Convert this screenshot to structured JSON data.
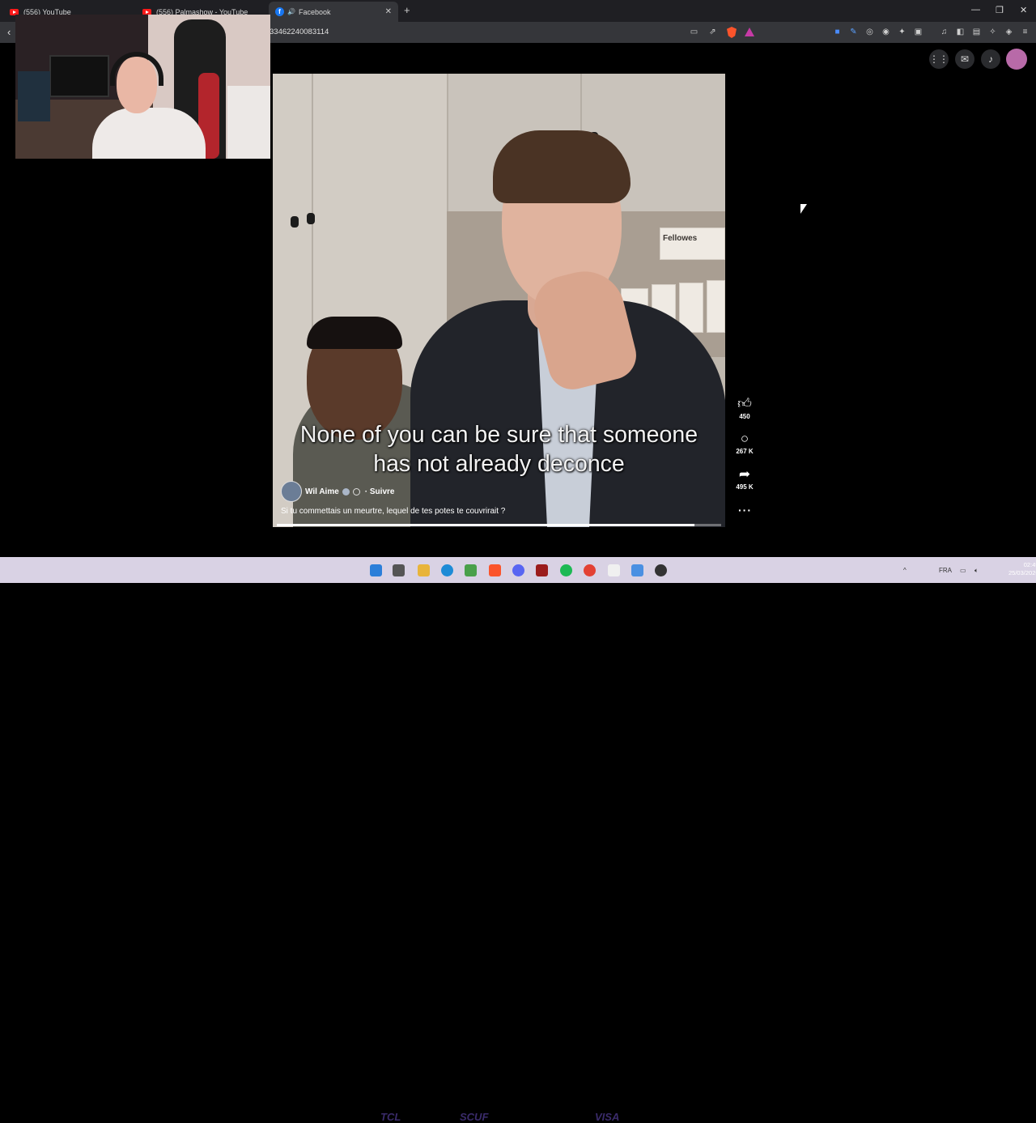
{
  "tabs": [
    {
      "title": "(556) YouTube"
    },
    {
      "title": "(556) Palmashow - YouTube"
    },
    {
      "title": "Facebook"
    }
  ],
  "address_bar": {
    "url": "33462240083114"
  },
  "video": {
    "subtitle_line1": "None of you can be sure that someone",
    "subtitle_line2": "has not already deconce",
    "author": "Wil Aime",
    "follow_label": "· Suivre",
    "caption": "Si tu commettais un meurtre, lequel de tes potes te couvrirait ?",
    "progress": 0.94,
    "box_label": "Fellowes"
  },
  "actions": {
    "likes": "450",
    "comments": "267 K",
    "shares": "495 K"
  },
  "taskbar": {
    "language": "FRA",
    "time": "02:49",
    "date": "25/03/2026"
  },
  "colors": {
    "facebook_blue": "#1877f2",
    "youtube_red": "#ff1a1a",
    "brave_orange": "#fb542b"
  }
}
